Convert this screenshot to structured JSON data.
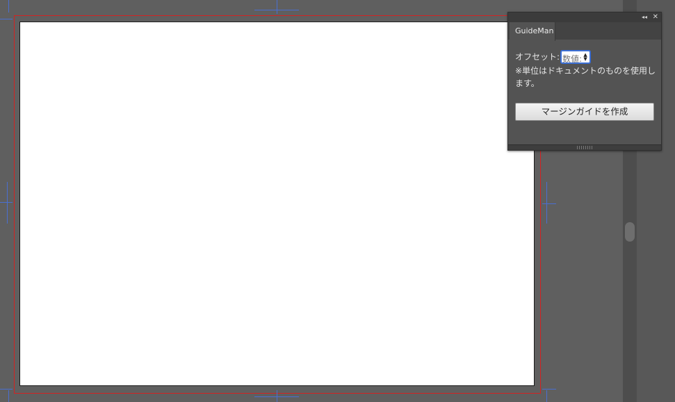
{
  "panel": {
    "tab_label": "GuideMan",
    "collapse_glyph": "◂◂",
    "close_glyph": "✕",
    "offset_label": "オフセット:",
    "offset_placeholder": "数値:",
    "offset_value": "",
    "stepper_up": "▲",
    "stepper_down": "▼",
    "note": "※単位はドキュメントのものを使用します。",
    "create_button_label": "マージンガイドを作成"
  },
  "icons": {
    "collapse": "double-left-arrow-icon",
    "close": "close-icon",
    "stepper": "spinner-arrows-icon"
  },
  "colors": {
    "pasteboard": "#5f5f5f",
    "artboard": "#ffffff",
    "bleed_line": "#d42222",
    "crop_marks": "#4a6fd1",
    "panel_bg": "#535353",
    "input_focus": "#3b6fd6"
  }
}
